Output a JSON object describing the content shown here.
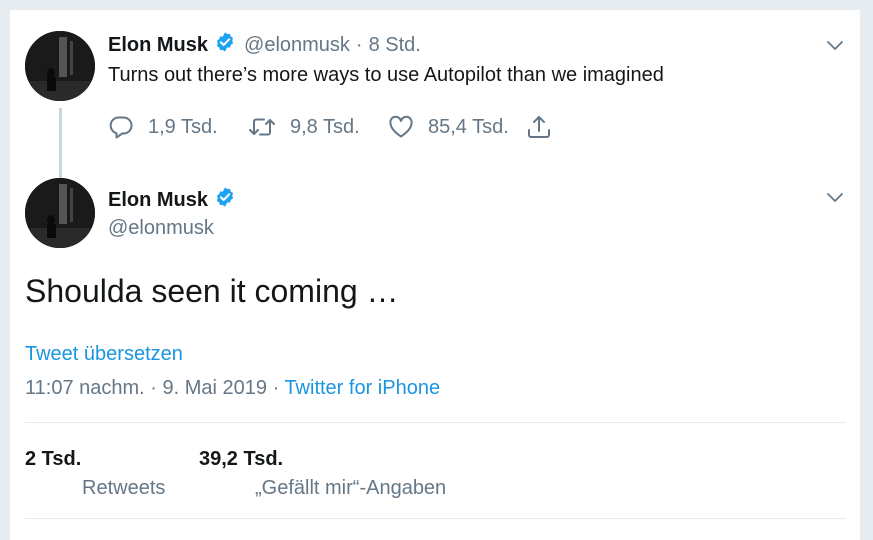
{
  "parent_tweet": {
    "author_name": "Elon Musk",
    "handle": "@elonmusk",
    "separator": "·",
    "time": "8 Std.",
    "text": "Turns out there’s more ways to use Autopilot than we imagined",
    "replies": "1,9 Tsd.",
    "retweets": "9,8 Tsd.",
    "likes": "85,4 Tsd.",
    "icons": [
      "reply-icon",
      "retweet-icon",
      "like-icon",
      "share-icon",
      "chevron-down-icon",
      "verified-badge-icon"
    ]
  },
  "main_tweet": {
    "author_name": "Elon Musk",
    "handle": "@elonmusk",
    "text": "Shoulda seen it coming …",
    "translate_link": "Tweet übersetzen",
    "timestamp": "11:07 nachm. · 9. Mai 2019",
    "meta_separator": "·",
    "source": "Twitter for iPhone",
    "stats": {
      "retweets_count": "2 Tsd.",
      "retweets_label": "Retweets",
      "likes_count": "39,2 Tsd.",
      "likes_label": "„Gefällt mir“-Angaben"
    }
  },
  "colors": {
    "background": "#e6ecf0",
    "card": "#ffffff",
    "text": "#14171a",
    "muted": "#657786",
    "accent": "#1b95e0",
    "verified": "#1da1f2",
    "thread_line": "#ccd6dd"
  }
}
